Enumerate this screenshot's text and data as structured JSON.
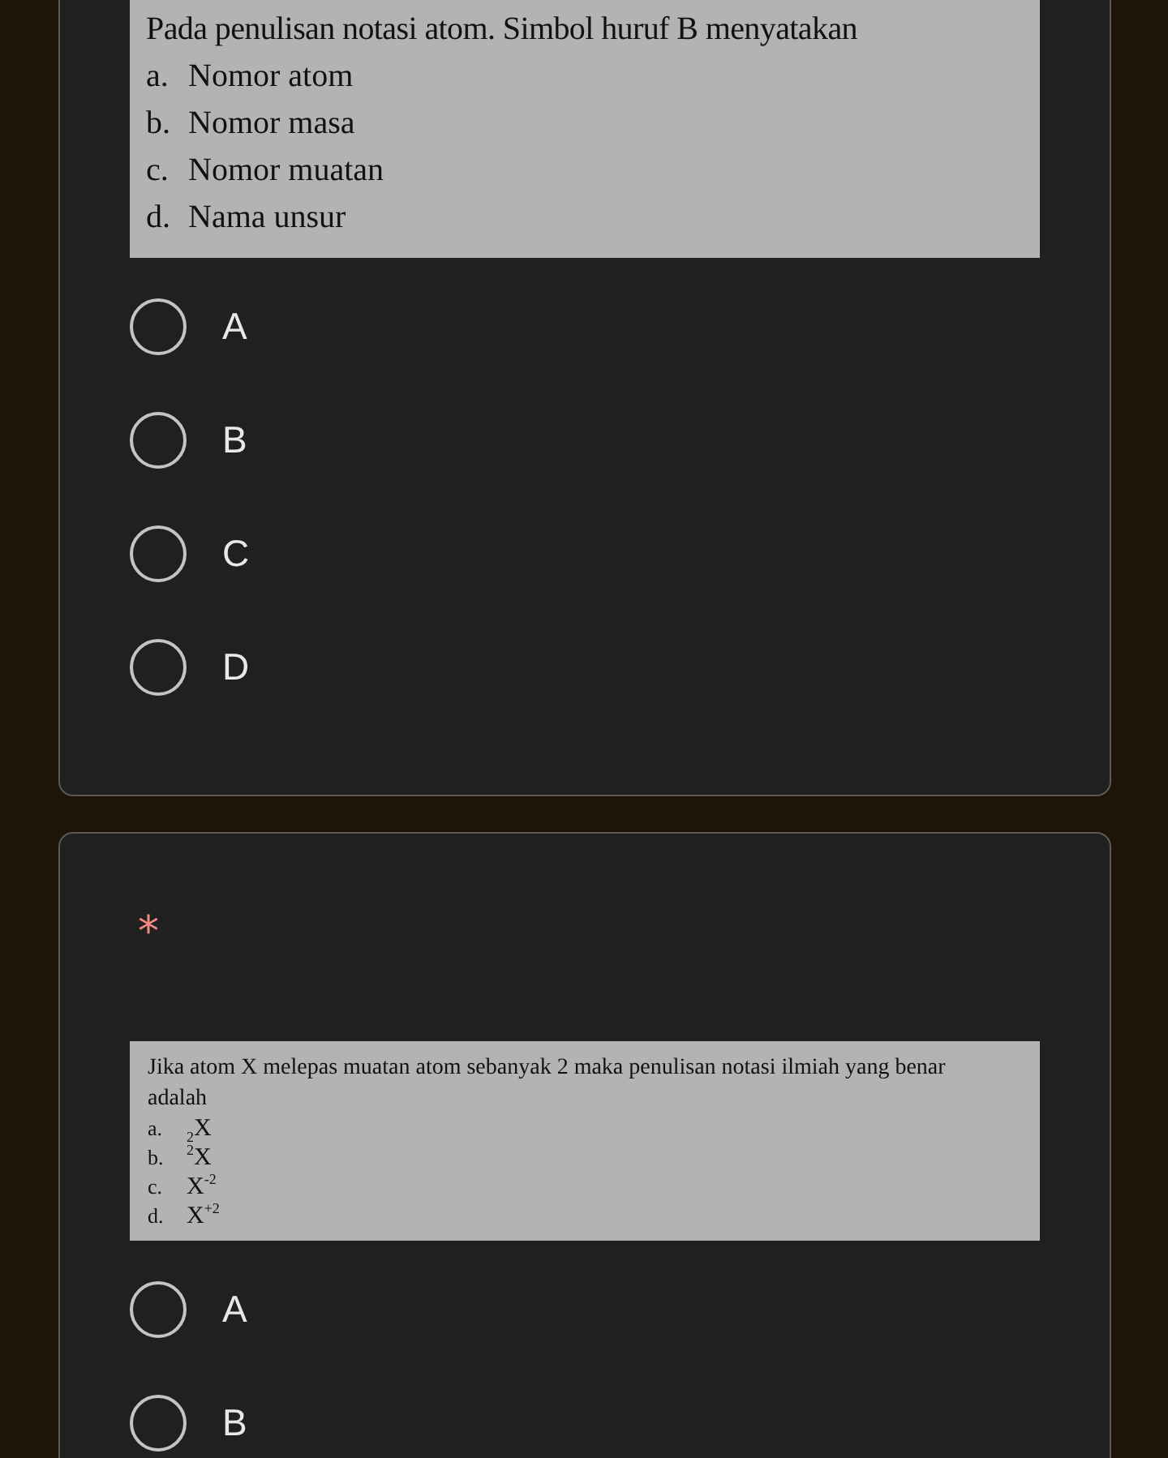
{
  "questions": [
    {
      "prompt": {
        "text": "Pada penulisan notasi atom. Simbol huruf B menyatakan",
        "choices": [
          {
            "letter": "a.",
            "text": "Nomor atom"
          },
          {
            "letter": "b.",
            "text": "Nomor masa"
          },
          {
            "letter": "c.",
            "text": "Nomor muatan"
          },
          {
            "letter": "d.",
            "text": "Nama unsur"
          }
        ]
      },
      "options": [
        {
          "label": "A",
          "selected": false
        },
        {
          "label": "B",
          "selected": false
        },
        {
          "label": "C",
          "selected": false
        },
        {
          "label": "D",
          "selected": false
        }
      ]
    },
    {
      "required_mark": "*",
      "prompt": {
        "text": "Jika  atom X melepas muatan atom sebanyak 2 maka penulisan notasi ilmiah  yang benar adalah",
        "choices": [
          {
            "letter": "a.",
            "text": "$_{2}$X"
          },
          {
            "letter": "b.",
            "text": "$^{2}$X"
          },
          {
            "letter": "c.",
            "text": "X$^{-2}$"
          },
          {
            "letter": "d.",
            "text": "X$^{+2}$"
          }
        ]
      },
      "options": [
        {
          "label": "A",
          "selected": false
        },
        {
          "label": "B",
          "selected": false
        }
      ]
    }
  ]
}
